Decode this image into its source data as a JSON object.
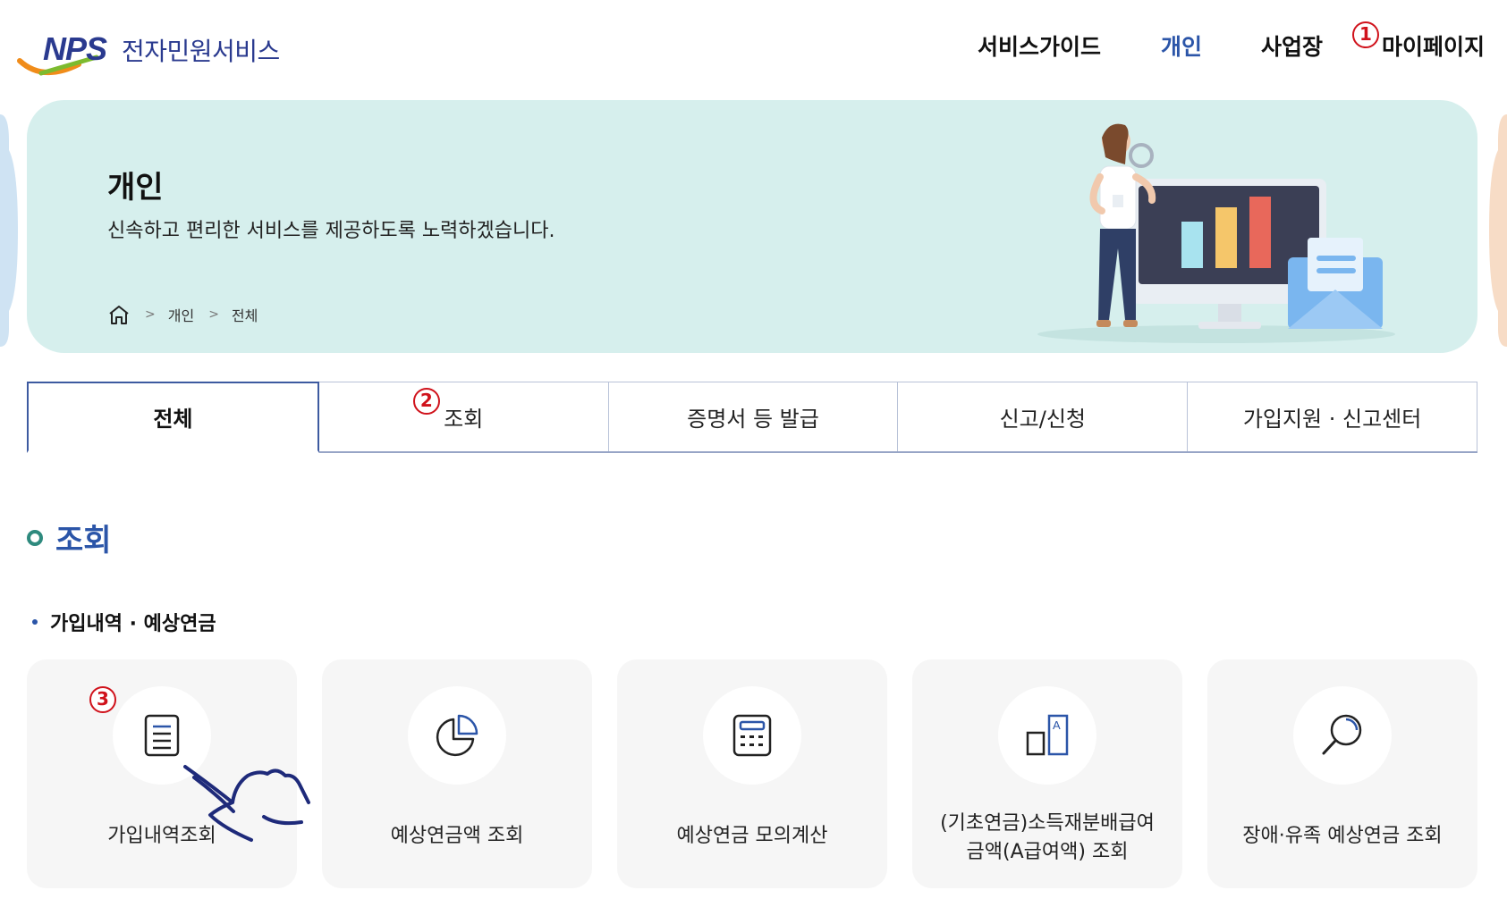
{
  "header": {
    "logo_text": "NPS",
    "logo_sub": "전자민원서비스",
    "nav": [
      {
        "label": "서비스가이드"
      },
      {
        "label": "개인"
      },
      {
        "label": "사업장"
      },
      {
        "label": "마이페이지",
        "badge": "1"
      }
    ]
  },
  "banner": {
    "title": "개인",
    "description": "신속하고 편리한 서비스를 제공하도록 노력하겠습니다.",
    "breadcrumb": [
      "개인",
      "전체"
    ]
  },
  "tabs": [
    {
      "label": "전체"
    },
    {
      "label": "조회",
      "badge": "2"
    },
    {
      "label": "증명서 등 발급"
    },
    {
      "label": "신고/신청"
    },
    {
      "label": "가입지원 · 신고센터"
    }
  ],
  "section": {
    "title": "조회",
    "subtitle": "가입내역 · 예상연금"
  },
  "cards": [
    {
      "label": "가입내역조회",
      "icon": "document-icon",
      "badge": "3"
    },
    {
      "label": "예상연금액 조회",
      "icon": "pie-chart-icon"
    },
    {
      "label": "예상연금 모의계산",
      "icon": "calculator-icon"
    },
    {
      "label_line1": "(기초연금)소득재분배급여",
      "label_line2": "금액(A급여액) 조회",
      "icon": "a-value-icon"
    },
    {
      "label": "장애·유족 예상연금 조회",
      "icon": "magnifier-icon"
    }
  ],
  "colors": {
    "brand": "#2a3a8f",
    "active": "#2b55a8",
    "banner_bg": "#d6efed",
    "annotation": "#d0121b"
  }
}
